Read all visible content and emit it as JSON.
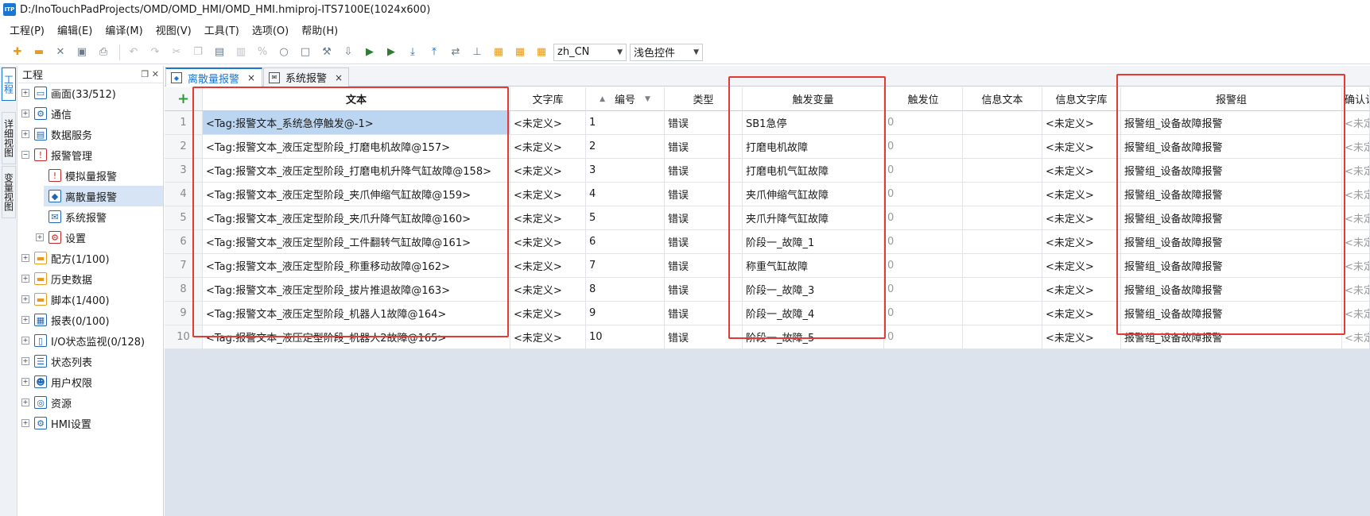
{
  "window": {
    "app_icon_text": "ITP",
    "title": "D:/InoTouchPadProjects/OMD/OMD_HMI/OMD_HMI.hmiproj-ITS7100E(1024x600)"
  },
  "menu": [
    "工程(P)",
    "编辑(E)",
    "编译(M)",
    "视图(V)",
    "工具(T)",
    "选项(O)",
    "帮助(H)"
  ],
  "toolbar": {
    "language_value": "zh_CN",
    "theme_value": "浅色控件"
  },
  "side_tabs": [
    "工程",
    "详细视图",
    "变量视图"
  ],
  "project_panel": {
    "title": "工程",
    "tree": [
      {
        "label": "画面(33/512)",
        "icon": "screen-icon"
      },
      {
        "label": "通信",
        "icon": "network-icon"
      },
      {
        "label": "数据服务",
        "icon": "data-service-icon"
      },
      {
        "label": "报警管理",
        "icon": "alarm-management-icon"
      },
      {
        "label": "模拟量报警",
        "icon": "analog-alarm-icon"
      },
      {
        "label": "离散量报警",
        "icon": "discrete-alarm-icon"
      },
      {
        "label": "系统报警",
        "icon": "system-alarm-icon"
      },
      {
        "label": "设置",
        "icon": "alarm-settings-icon"
      },
      {
        "label": "配方(1/100)",
        "icon": "recipe-icon"
      },
      {
        "label": "历史数据",
        "icon": "history-data-icon"
      },
      {
        "label": "脚本(1/400)",
        "icon": "script-icon"
      },
      {
        "label": "报表(0/100)",
        "icon": "report-icon"
      },
      {
        "label": "I/O状态监视(0/128)",
        "icon": "io-monitor-icon"
      },
      {
        "label": "状态列表",
        "icon": "status-list-icon"
      },
      {
        "label": "用户权限",
        "icon": "users-icon"
      },
      {
        "label": "资源",
        "icon": "resources-icon"
      },
      {
        "label": "HMI设置",
        "icon": "hmi-settings-icon"
      }
    ]
  },
  "doc_tabs": [
    {
      "label": "离散量报警",
      "close": "×"
    },
    {
      "label": "系统报警",
      "close": "×"
    }
  ],
  "grid": {
    "add_symbol": "+",
    "columns": [
      "文本",
      "文字库",
      "编号",
      "类型",
      "触发变量",
      "触发位",
      "信息文本",
      "信息文字库",
      "报警组",
      "确认认"
    ],
    "rows": [
      {
        "n": "1",
        "text": "<Tag:报警文本_系统急停触发@-1>",
        "lib": "<未定义>",
        "id": "1",
        "type": "错误",
        "trigger": "SB1急停",
        "bit": "0",
        "info": "",
        "info_lib": "<未定义>",
        "group": "报警组_设备故障报警",
        "ack": "<未定"
      },
      {
        "n": "2",
        "text": "<Tag:报警文本_液压定型阶段_打磨电机故障@157>",
        "lib": "<未定义>",
        "id": "2",
        "type": "错误",
        "trigger": "打磨电机故障",
        "bit": "0",
        "info": "",
        "info_lib": "<未定义>",
        "group": "报警组_设备故障报警",
        "ack": "<未定"
      },
      {
        "n": "3",
        "text": "<Tag:报警文本_液压定型阶段_打磨电机升降气缸故障@158>",
        "lib": "<未定义>",
        "id": "3",
        "type": "错误",
        "trigger": "打磨电机气缸故障",
        "bit": "0",
        "info": "",
        "info_lib": "<未定义>",
        "group": "报警组_设备故障报警",
        "ack": "<未定"
      },
      {
        "n": "4",
        "text": "<Tag:报警文本_液压定型阶段_夹爪伸缩气缸故障@159>",
        "lib": "<未定义>",
        "id": "4",
        "type": "错误",
        "trigger": "夹爪伸缩气缸故障",
        "bit": "0",
        "info": "",
        "info_lib": "<未定义>",
        "group": "报警组_设备故障报警",
        "ack": "<未定"
      },
      {
        "n": "5",
        "text": "<Tag:报警文本_液压定型阶段_夹爪升降气缸故障@160>",
        "lib": "<未定义>",
        "id": "5",
        "type": "错误",
        "trigger": "夹爪升降气缸故障",
        "bit": "0",
        "info": "",
        "info_lib": "<未定义>",
        "group": "报警组_设备故障报警",
        "ack": "<未定"
      },
      {
        "n": "6",
        "text": "<Tag:报警文本_液压定型阶段_工件翻转气缸故障@161>",
        "lib": "<未定义>",
        "id": "6",
        "type": "错误",
        "trigger": "阶段一_故障_1",
        "bit": "0",
        "info": "",
        "info_lib": "<未定义>",
        "group": "报警组_设备故障报警",
        "ack": "<未定"
      },
      {
        "n": "7",
        "text": "<Tag:报警文本_液压定型阶段_称重移动故障@162>",
        "lib": "<未定义>",
        "id": "7",
        "type": "错误",
        "trigger": "称重气缸故障",
        "bit": "0",
        "info": "",
        "info_lib": "<未定义>",
        "group": "报警组_设备故障报警",
        "ack": "<未定"
      },
      {
        "n": "8",
        "text": "<Tag:报警文本_液压定型阶段_拔片推退故障@163>",
        "lib": "<未定义>",
        "id": "8",
        "type": "错误",
        "trigger": "阶段一_故障_3",
        "bit": "0",
        "info": "",
        "info_lib": "<未定义>",
        "group": "报警组_设备故障报警",
        "ack": "<未定"
      },
      {
        "n": "9",
        "text": "<Tag:报警文本_液压定型阶段_机器人1故障@164>",
        "lib": "<未定义>",
        "id": "9",
        "type": "错误",
        "trigger": "阶段一_故障_4",
        "bit": "0",
        "info": "",
        "info_lib": "<未定义>",
        "group": "报警组_设备故障报警",
        "ack": "<未定"
      },
      {
        "n": "10",
        "text": "<Tag:报警文本_液压定型阶段_机器人2故障@165>",
        "lib": "<未定义>",
        "id": "10",
        "type": "错误",
        "trigger": "阶段一_故障_5",
        "bit": "0",
        "info": "",
        "info_lib": "<未定义>",
        "group": "报警组_设备故障报警",
        "ack": "<未定"
      }
    ]
  },
  "colors": {
    "accent": "#1976d2",
    "selection": "#bcd6f2",
    "annotation_red": "#e53935",
    "empty_area": "#dde3ec"
  }
}
